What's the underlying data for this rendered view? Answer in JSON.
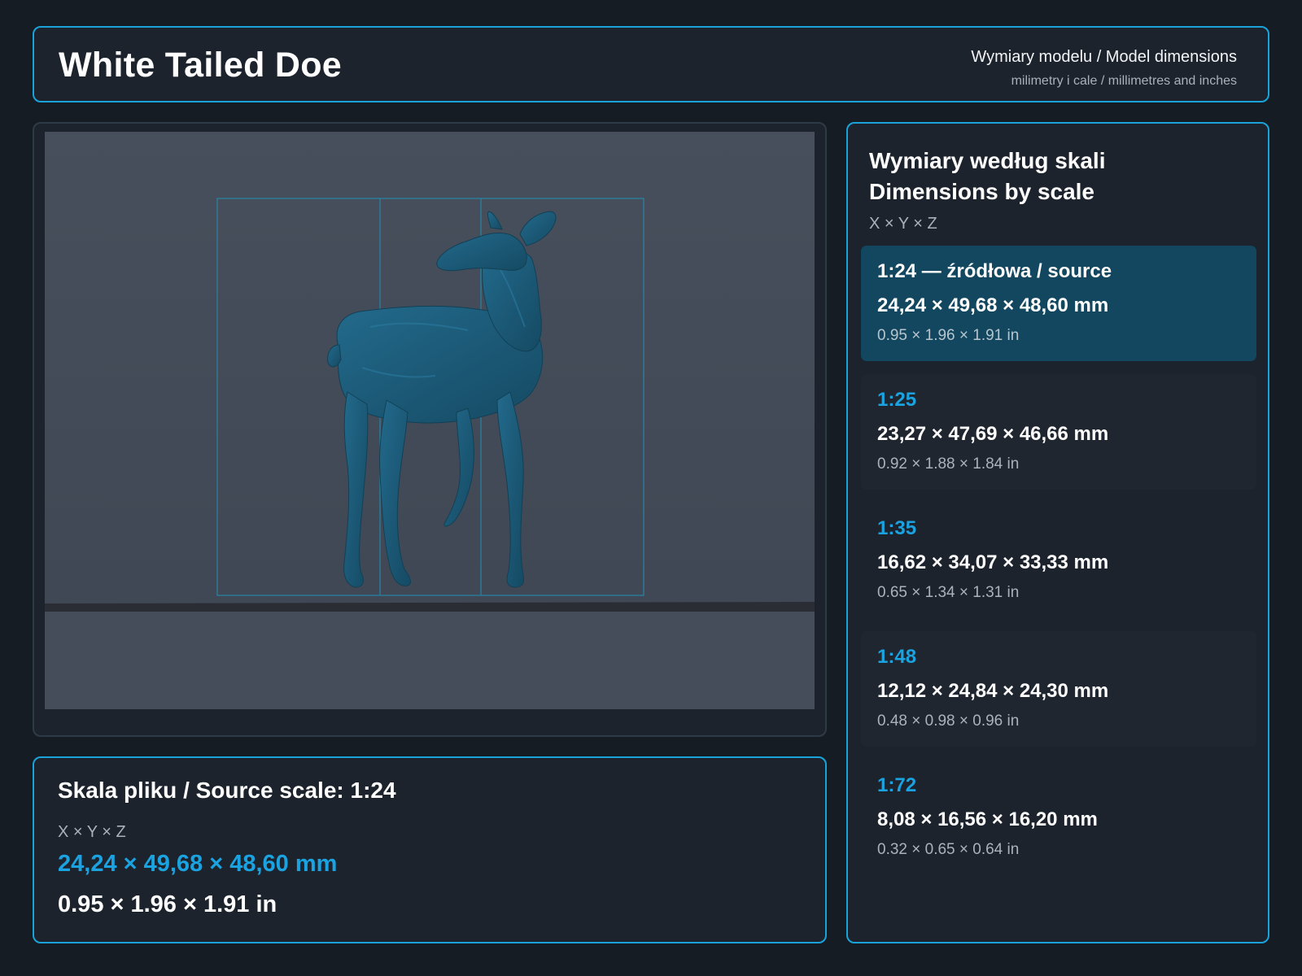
{
  "header": {
    "title": "White Tailed Doe",
    "subtitle": "Wymiary modelu / Model dimensions",
    "units_note": "milimetry i cale / millimetres and inches"
  },
  "viewer": {
    "model_name": "White Tailed Doe"
  },
  "source_info": {
    "title": "Skala pliku / Source scale: 1:24",
    "axes": "X × Y × Z",
    "mm": "24,24 × 49,68 × 48,60 mm",
    "inches": "0.95 × 1.96 × 1.91 in"
  },
  "scales_panel": {
    "title_pl": "Wymiary według skali",
    "title_en": "Dimensions by scale",
    "axes": "X × Y × Z",
    "items": [
      {
        "label": "1:24  —  źródłowa / source",
        "mm": "24,24 × 49,68 × 48,60 mm",
        "inches": "0.95 × 1.96 × 1.91 in"
      },
      {
        "label": "1:25",
        "mm": "23,27 × 47,69 × 46,66 mm",
        "inches": "0.92 × 1.88 × 1.84 in"
      },
      {
        "label": "1:35",
        "mm": "16,62 × 34,07 × 33,33 mm",
        "inches": "0.65 × 1.34 × 1.31 in"
      },
      {
        "label": "1:48",
        "mm": "12,12 × 24,84 × 24,30 mm",
        "inches": "0.48 × 0.98 × 0.96 in"
      },
      {
        "label": "1:72",
        "mm": "8,08 × 16,56 × 16,20 mm",
        "inches": "0.32 × 0.65 × 0.64 in"
      }
    ]
  },
  "colors": {
    "accent": "#1aa3d9",
    "background": "#161c24",
    "panel": "#1c232d",
    "selected_card": "#12475f",
    "model": "#1d5a78"
  }
}
